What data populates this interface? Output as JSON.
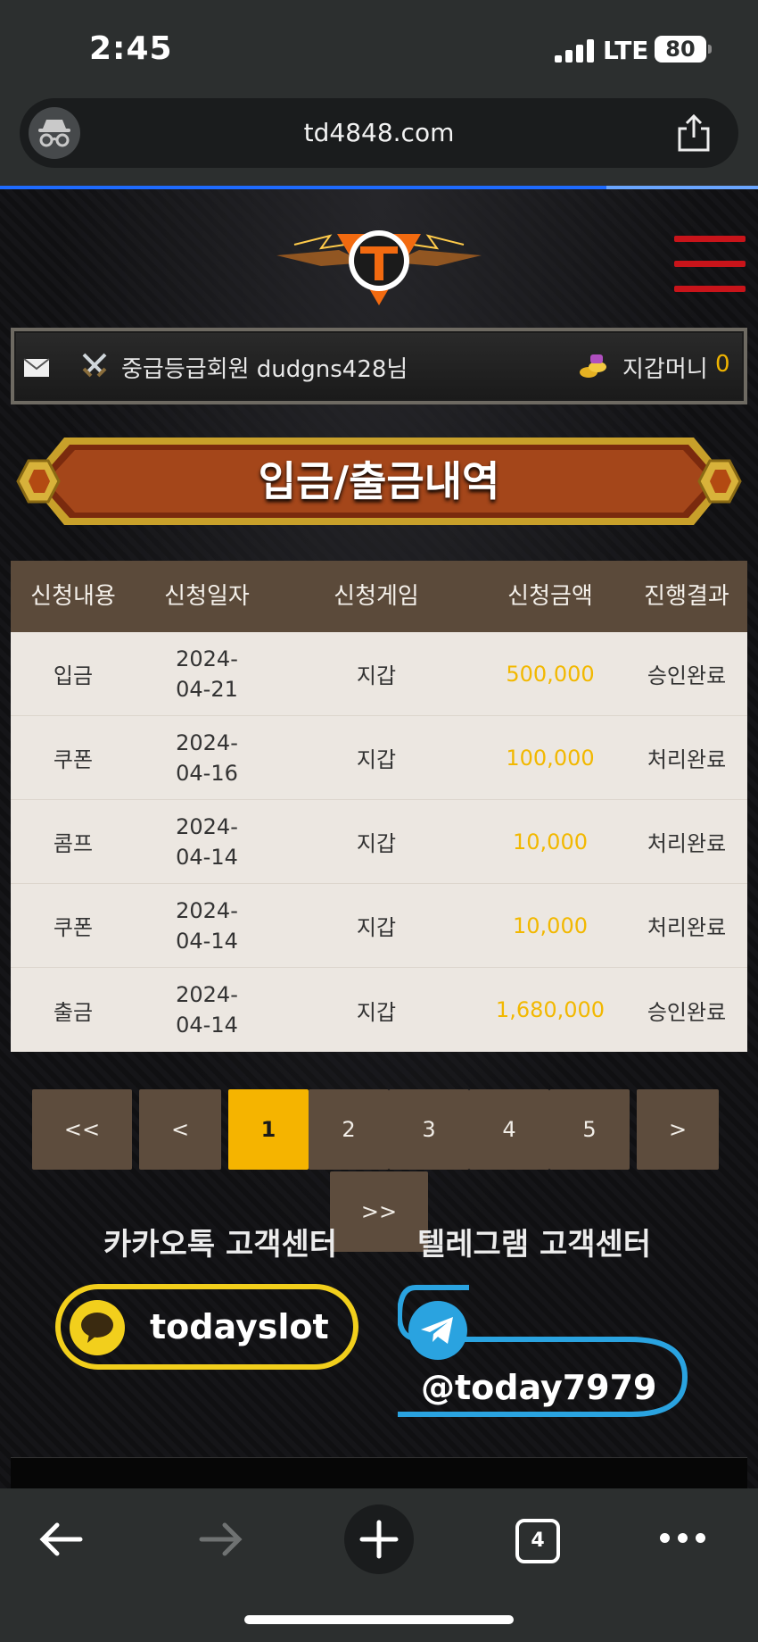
{
  "status_bar": {
    "time": "2:45",
    "network": "LTE",
    "battery": "80"
  },
  "browser": {
    "url": "td4848.com",
    "load_progress": 0.8,
    "tab_count": "4"
  },
  "user_bar": {
    "member_text": "중급등급회원 dudgns428님",
    "wallet_label": "지갑머니",
    "wallet_value": "0"
  },
  "banner": {
    "title": "입금/출금내역"
  },
  "table": {
    "headers": [
      "신청내용",
      "신청일자",
      "신청게임",
      "신청금액",
      "진행결과"
    ],
    "rows": [
      {
        "type": "입금",
        "date": "2024-04-21",
        "game": "지갑",
        "amount": "500,000",
        "status": "승인완료"
      },
      {
        "type": "쿠폰",
        "date": "2024-04-16",
        "game": "지갑",
        "amount": "100,000",
        "status": "처리완료"
      },
      {
        "type": "콤프",
        "date": "2024-04-14",
        "game": "지갑",
        "amount": "10,000",
        "status": "처리완료"
      },
      {
        "type": "쿠폰",
        "date": "2024-04-14",
        "game": "지갑",
        "amount": "10,000",
        "status": "처리완료"
      },
      {
        "type": "출금",
        "date": "2024-04-14",
        "game": "지갑",
        "amount": "1,680,000",
        "status": "승인완료"
      }
    ]
  },
  "pagination": {
    "first": "<<",
    "prev": "<",
    "pages": [
      "1",
      "2",
      "3",
      "4",
      "5"
    ],
    "next": ">",
    "last": ">>",
    "current": "1"
  },
  "support": {
    "kakao_title": "카카오톡 고객센터",
    "telegram_title": "텔레그램 고객센터",
    "kakao_id": "todayslot",
    "telegram_id": "@today7979"
  },
  "colors": {
    "accent_gold": "#f2b800",
    "table_header": "#5b4a3a",
    "menu_red": "#c8141a",
    "kakao_yellow": "#f2cf1c",
    "telegram_blue": "#2aa3e0"
  },
  "icons": [
    "incognito-icon",
    "share-icon",
    "menu-icon",
    "mail-icon",
    "crossed-swords-icon",
    "gold-coins-icon",
    "kakao-chat-icon",
    "telegram-icon",
    "back-arrow-icon",
    "forward-arrow-icon",
    "plus-icon",
    "more-icon"
  ]
}
